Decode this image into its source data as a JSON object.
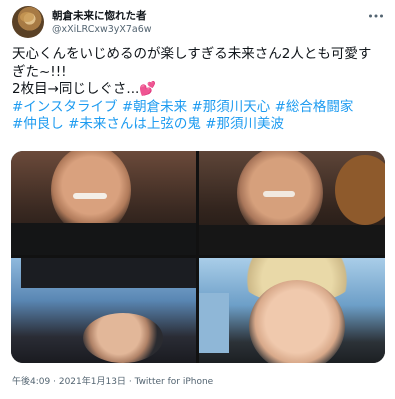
{
  "user": {
    "name": "朝倉未来に惚れた者",
    "handle": "@xXiLRCxw3yX7a6w"
  },
  "more_icon": "more-dots-icon",
  "tweet": {
    "line1": "天心くんをいじめるのが楽しすぎる未来さん2人とも可愛すぎた~!!!",
    "line2": "2枚目→同じしぐさ...",
    "heart": "💕",
    "hashtags_line1": [
      "#インスタライブ",
      "#朝倉未来",
      "#那須川天心",
      "#総合格闘家"
    ],
    "hashtags_line2": [
      "#仲良し",
      "#未来さんは上弦の鬼",
      "#那須川美波"
    ]
  },
  "footer": {
    "time": "午後4:09",
    "separator": "·",
    "date": "2021年1月13日",
    "source": "Twitter for iPhone"
  }
}
